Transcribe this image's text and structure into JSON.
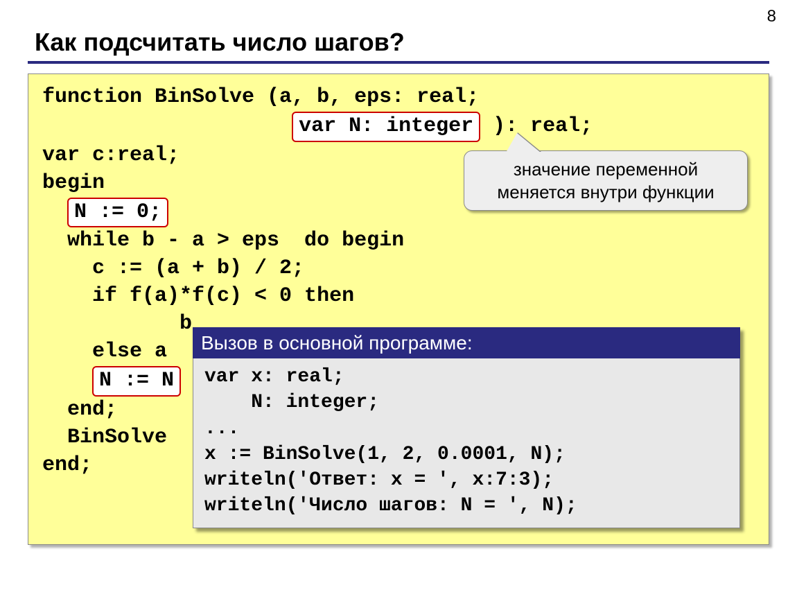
{
  "page_number": "8",
  "title": "Как подсчитать число шагов?",
  "code": {
    "l1a": "function BinSolve (a, b, eps: real;",
    "l2_indent": "                    ",
    "l2_hl": "var N: integer",
    "l2b": " ): real;",
    "l3": "var c:real;",
    "l4": "begin",
    "l5_indent": "  ",
    "l5_hl": "N := 0;",
    "l6": "  while b - a > eps  do begin",
    "l7": "    c := (a + b) / 2;",
    "l8": "    if f(a)*f(c) < 0 then",
    "l9": "           b",
    "l10": "    else a",
    "l11_indent": "    ",
    "l11_hl": "N := N",
    "l12": "  end;",
    "l13": "  BinSolve",
    "l14": "end;"
  },
  "callout": {
    "line1": "значение переменной",
    "line2": "меняется внутри функции"
  },
  "subpanel": {
    "header": "Вызов в основной программе:",
    "b1": "var x: real;",
    "b2": "    N: integer;",
    "b3": "...",
    "b4": "x := BinSolve(1, 2, 0.0001, N);",
    "b5": "writeln('Ответ: x = ', x:7:3);",
    "b6": "writeln('Число шагов: N = ', N);"
  }
}
